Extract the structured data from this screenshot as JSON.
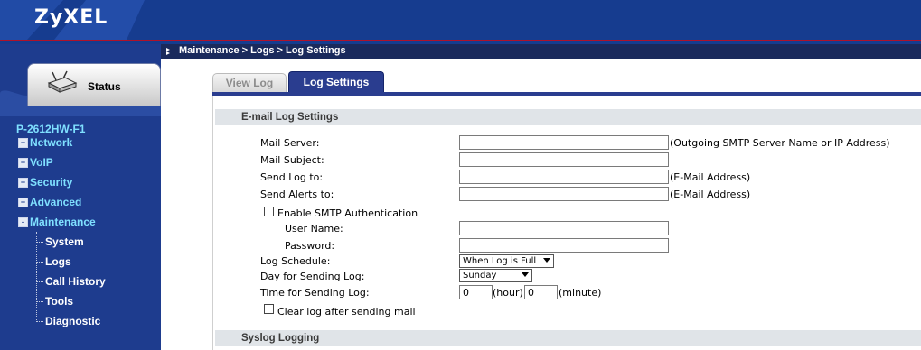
{
  "brand": {
    "logo_text": "ZyXEL"
  },
  "header": {
    "breadcrumb": "Maintenance > Logs > Log Settings"
  },
  "sidebar": {
    "status_label": "Status",
    "model": "P-2612HW-F1",
    "menu": [
      {
        "label": "Network",
        "expander": "+"
      },
      {
        "label": "VoIP",
        "expander": "+"
      },
      {
        "label": "Security",
        "expander": "+"
      },
      {
        "label": "Advanced",
        "expander": "+"
      },
      {
        "label": "Maintenance",
        "expander": "-"
      }
    ],
    "submenu": [
      "System",
      "Logs",
      "Call History",
      "Tools",
      "Diagnostic"
    ]
  },
  "tabs": [
    {
      "label": "View Log",
      "active": false
    },
    {
      "label": "Log Settings",
      "active": true
    }
  ],
  "email_section": {
    "title": "E-mail Log Settings",
    "mail_server": {
      "label": "Mail Server:",
      "value": "",
      "hint": "(Outgoing SMTP Server Name or IP Address)"
    },
    "mail_subject": {
      "label": "Mail Subject:",
      "value": ""
    },
    "send_log_to": {
      "label": "Send Log to:",
      "value": "",
      "hint": "(E-Mail Address)"
    },
    "send_alerts_to": {
      "label": "Send Alerts to:",
      "value": "",
      "hint": "(E-Mail Address)"
    },
    "smtp_auth": {
      "label": "Enable SMTP Authentication",
      "checked": false
    },
    "user_name": {
      "label": "User Name:",
      "value": ""
    },
    "password": {
      "label": "Password:",
      "value": ""
    },
    "log_schedule": {
      "label": "Log Schedule:",
      "value": "When Log is Full"
    },
    "day_sending": {
      "label": "Day for Sending Log:",
      "value": "Sunday"
    },
    "time_sending": {
      "label": "Time for Sending Log:",
      "hour": "0",
      "hour_unit": "(hour)",
      "minute": "0",
      "minute_unit": "(minute)"
    },
    "clear_log": {
      "label": "Clear log after sending mail",
      "checked": false
    }
  },
  "syslog_section": {
    "title": "Syslog Logging"
  },
  "colors": {
    "banner": "#163c8f",
    "accent_red": "#b0122a",
    "sidebar": "#1e3c8e",
    "menu_text": "#7fe0ff",
    "active_tab": "#2a3d8f"
  }
}
